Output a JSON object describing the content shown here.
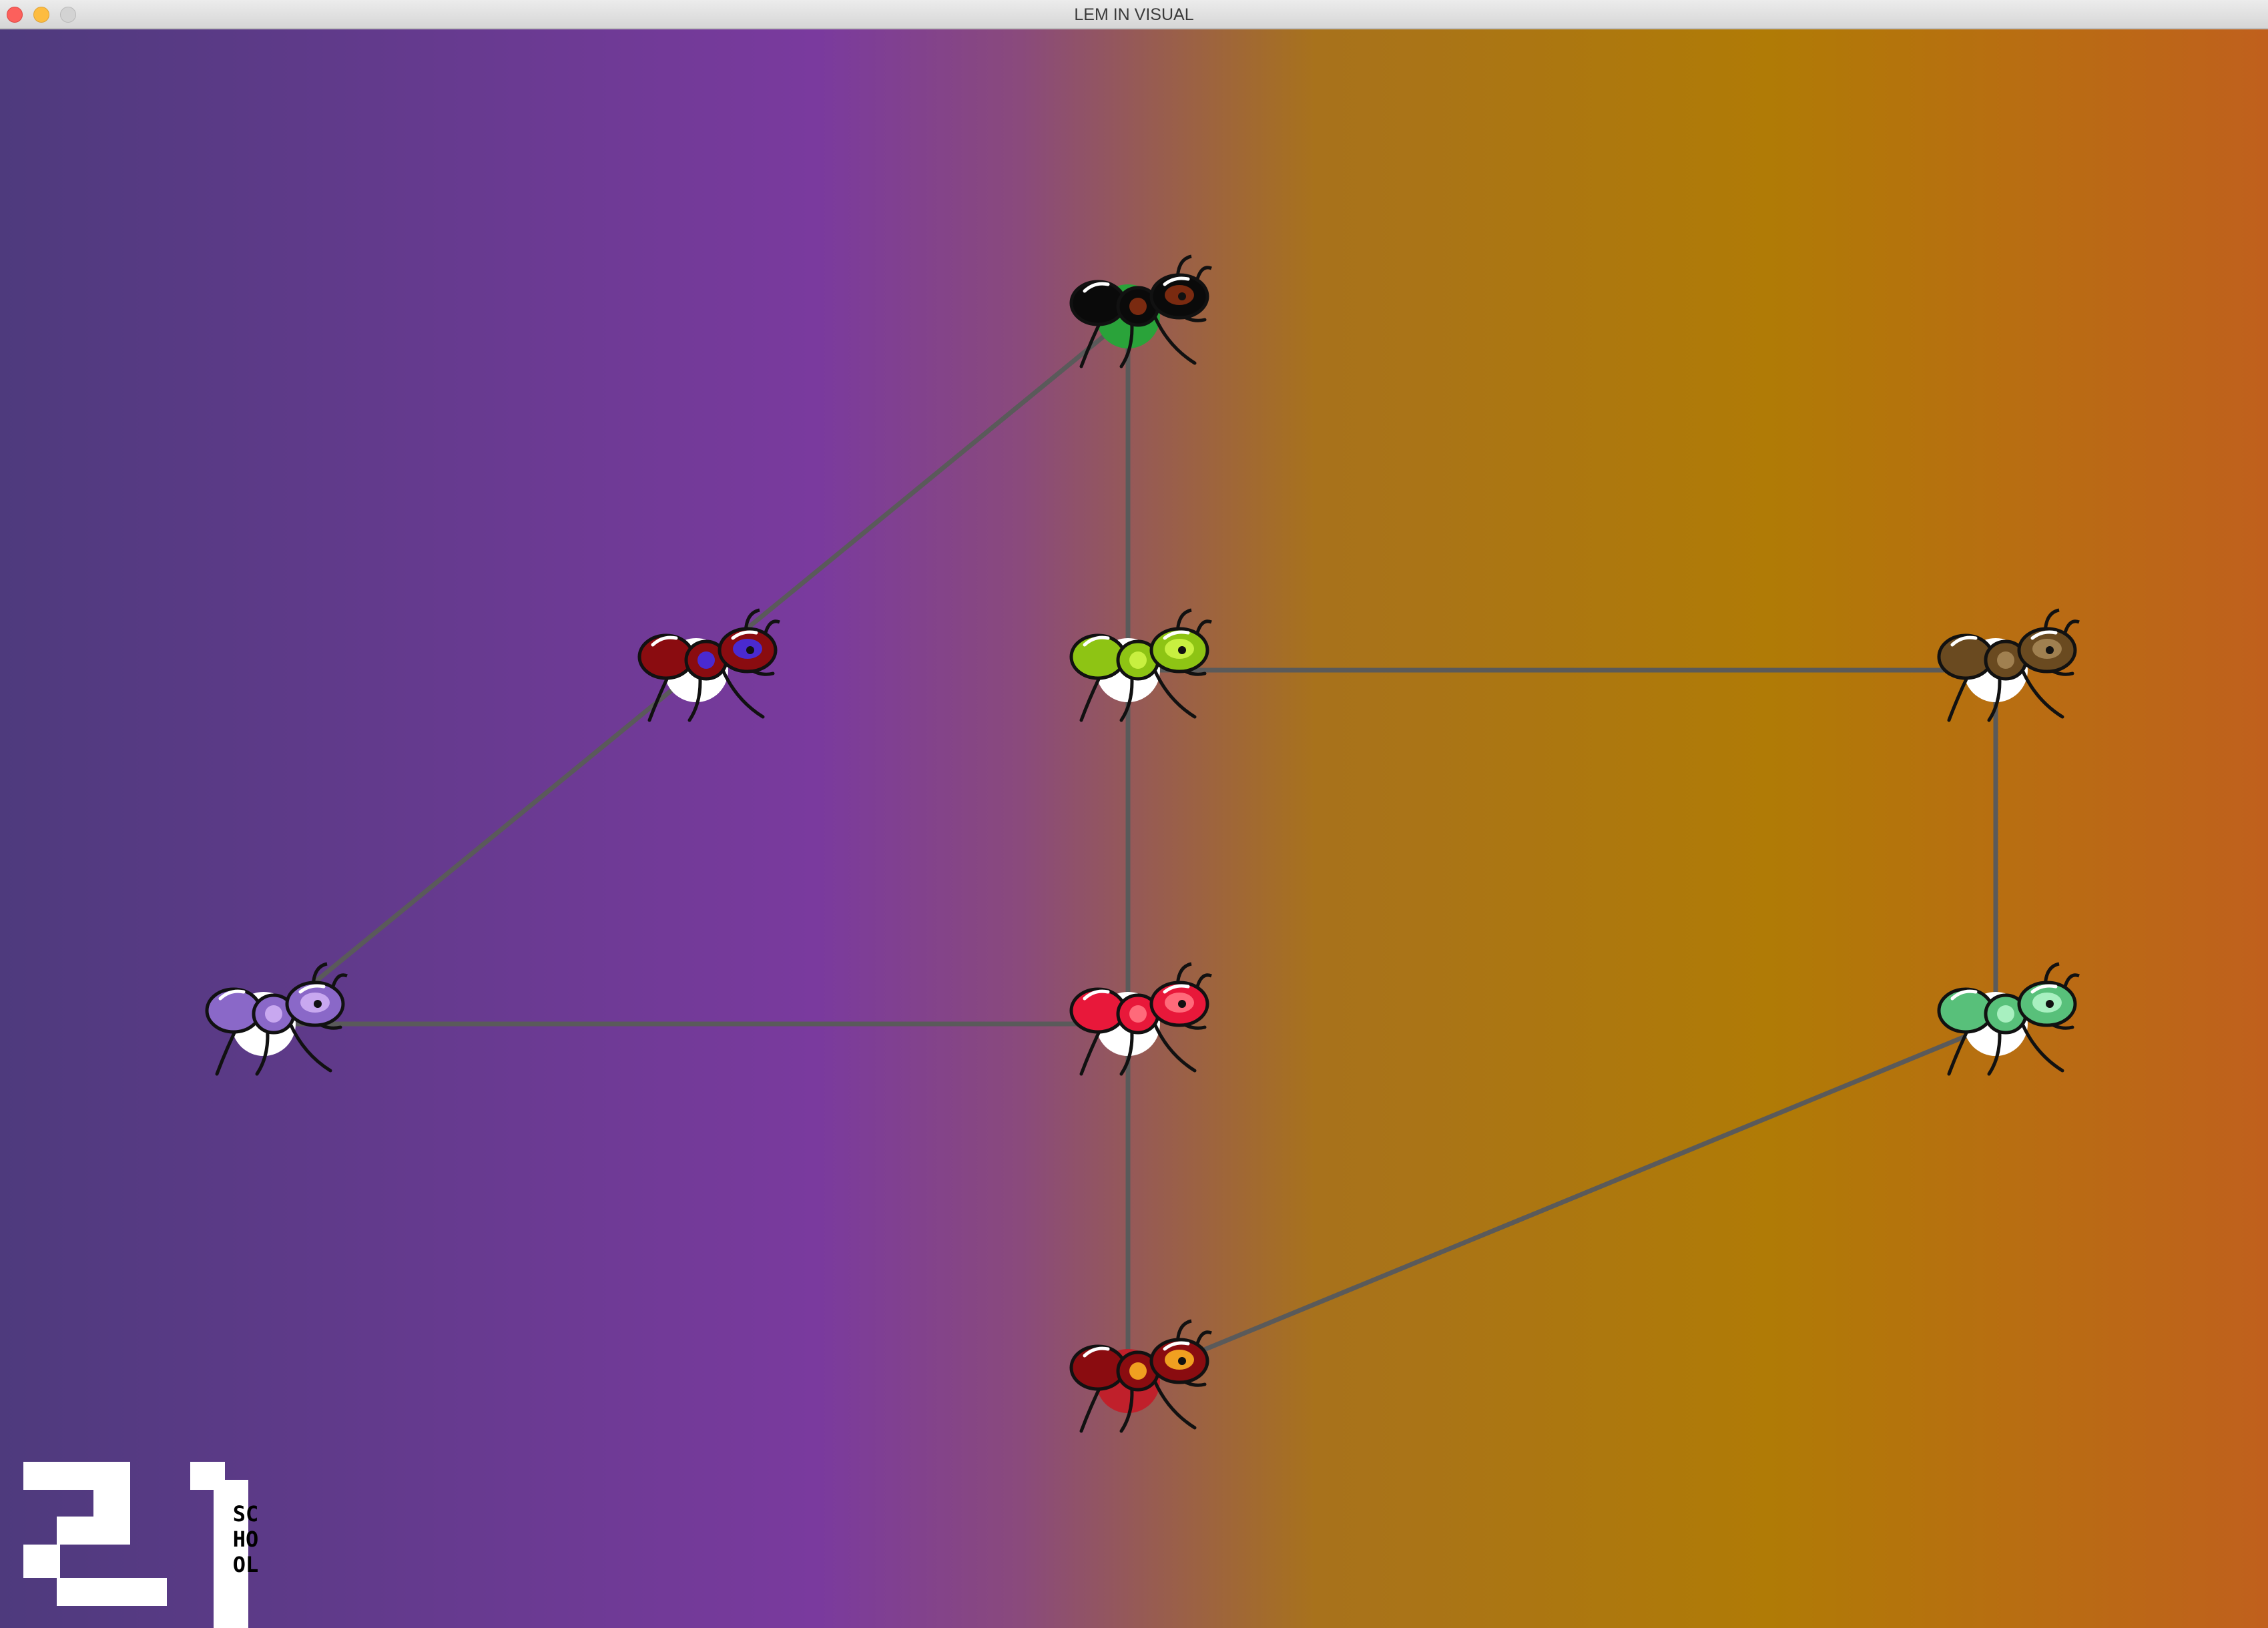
{
  "window": {
    "title": "LEM IN VISUAL"
  },
  "colors": {
    "background_left": "#4e3a7d",
    "background_mid": "#7a3d9c",
    "background_right_mid": "#b07b06",
    "background_right": "#c0601d",
    "link": "#5a5a5a",
    "start_room": "#2aa33a",
    "end_room": "#c0202b",
    "room": "#ffffff"
  },
  "rooms": [
    {
      "id": "room-top",
      "kind": "start",
      "ant_color": "black",
      "body": "#0a0a0a",
      "accent": "#7a2a10"
    },
    {
      "id": "room-upper-left",
      "kind": "normal",
      "ant_color": "red-purple",
      "body": "#8a0c10",
      "accent": "#4a2ad0"
    },
    {
      "id": "room-center-upper",
      "kind": "normal",
      "ant_color": "yellow-green",
      "body": "#8ec414",
      "accent": "#c8f040"
    },
    {
      "id": "room-upper-right",
      "kind": "normal",
      "ant_color": "brown",
      "body": "#6a4a20",
      "accent": "#a08050"
    },
    {
      "id": "room-left",
      "kind": "normal",
      "ant_color": "lavender",
      "body": "#8a68c8",
      "accent": "#c8a8f0"
    },
    {
      "id": "room-center-lower",
      "kind": "normal",
      "ant_color": "red",
      "body": "#e8183a",
      "accent": "#ff6a7a"
    },
    {
      "id": "room-lower-right",
      "kind": "normal",
      "ant_color": "mint",
      "body": "#58c07a",
      "accent": "#a8f0c0"
    },
    {
      "id": "room-bottom",
      "kind": "end",
      "ant_color": "dark-red",
      "body": "#8a0c10",
      "accent": "#f0a020"
    }
  ],
  "links": [
    [
      "room-top",
      "room-upper-left"
    ],
    [
      "room-top",
      "room-center-upper"
    ],
    [
      "room-upper-left",
      "room-left"
    ],
    [
      "room-left",
      "room-center-lower"
    ],
    [
      "room-center-upper",
      "room-center-lower"
    ],
    [
      "room-center-upper",
      "room-upper-right"
    ],
    [
      "room-upper-right",
      "room-lower-right"
    ],
    [
      "room-center-lower",
      "room-bottom"
    ],
    [
      "room-lower-right",
      "room-bottom"
    ]
  ],
  "logo": {
    "number": "21",
    "word": "SCHOOL"
  }
}
